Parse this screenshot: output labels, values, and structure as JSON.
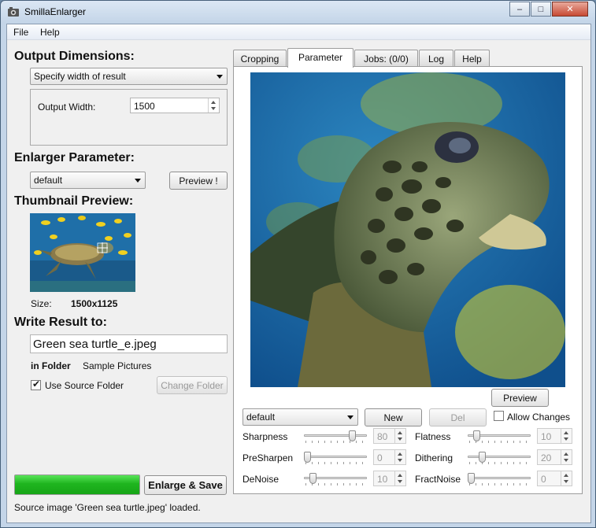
{
  "window": {
    "title": "SmillaEnlarger"
  },
  "menu": {
    "file": "File",
    "help": "Help"
  },
  "window_controls": {
    "minimize": "–",
    "maximize": "□",
    "close": "✕"
  },
  "output": {
    "heading": "Output Dimensions:",
    "mode": "Specify width of result",
    "width_label": "Output Width:",
    "width_value": "1500"
  },
  "enlarger": {
    "heading": "Enlarger Parameter:",
    "preset": "default",
    "preview_button": "Preview !"
  },
  "thumbnail": {
    "heading": "Thumbnail Preview:",
    "size_label": "Size:",
    "size_value": "1500x1125"
  },
  "write": {
    "heading": "Write Result to:",
    "filename": "Green sea turtle_e.jpeg",
    "folder_label": "in Folder",
    "folder_value": "Sample Pictures",
    "use_source_label": "Use Source Folder",
    "use_source_checked": true,
    "change_folder_button": "Change Folder"
  },
  "progress": {
    "value": 1.0
  },
  "enlarge_save_button": "Enlarge & Save",
  "status": "Source image 'Green sea turtle.jpeg' loaded.",
  "tabs": [
    "Cropping",
    "Parameter",
    "Jobs: (0/0)",
    "Log",
    "Help"
  ],
  "active_tab": "Parameter",
  "param": {
    "preview_button": "Preview",
    "preset": "default",
    "new_button": "New",
    "del_button": "Del",
    "allow_changes_label": "Allow Changes",
    "sliders": [
      {
        "label": "Sharpness",
        "value": "80",
        "fraction": 0.8
      },
      {
        "label": "Flatness",
        "value": "10",
        "fraction": 0.1
      },
      {
        "label": "PreSharpen",
        "value": "0",
        "fraction": 0.0
      },
      {
        "label": "Dithering",
        "value": "20",
        "fraction": 0.2
      },
      {
        "label": "DeNoise",
        "value": "10",
        "fraction": 0.1
      },
      {
        "label": "FractNoise",
        "value": "0",
        "fraction": 0.0
      }
    ]
  }
}
